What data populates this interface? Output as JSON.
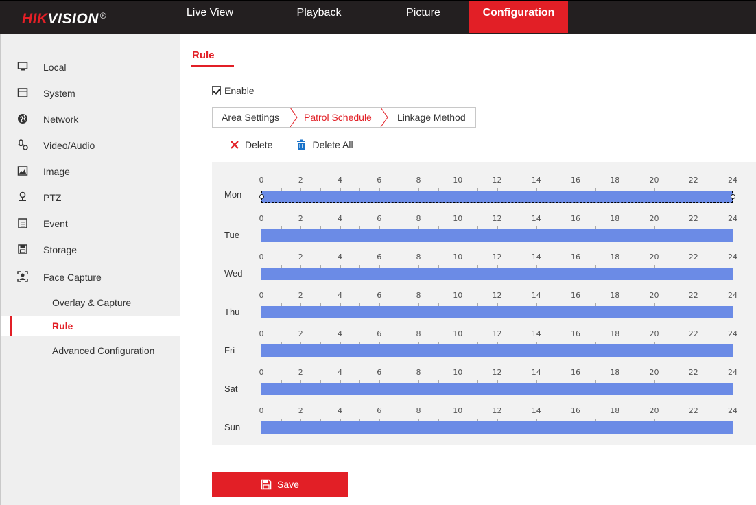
{
  "brand": {
    "logo_red": "HIK",
    "logo_white": "VISION",
    "logo_reg": "®"
  },
  "nav": {
    "tabs": [
      {
        "label": "Live View"
      },
      {
        "label": "Playback"
      },
      {
        "label": "Picture"
      },
      {
        "label": "Configuration",
        "active": true
      }
    ]
  },
  "sidebar": {
    "items": [
      {
        "label": "Local",
        "icon": "monitor-icon"
      },
      {
        "label": "System",
        "icon": "system-icon"
      },
      {
        "label": "Network",
        "icon": "globe-icon"
      },
      {
        "label": "Video/Audio",
        "icon": "video-audio-icon"
      },
      {
        "label": "Image",
        "icon": "image-icon"
      },
      {
        "label": "PTZ",
        "icon": "ptz-icon"
      },
      {
        "label": "Event",
        "icon": "event-icon"
      },
      {
        "label": "Storage",
        "icon": "storage-icon"
      },
      {
        "label": "Face Capture",
        "icon": "face-capture-icon"
      }
    ],
    "subitems": [
      {
        "label": "Overlay & Capture"
      },
      {
        "label": "Rule",
        "active": true
      },
      {
        "label": "Advanced Configuration"
      }
    ]
  },
  "page": {
    "tab_label": "Rule",
    "enable_label": "Enable",
    "enable_checked": true,
    "subtabs": [
      {
        "label": "Area Settings"
      },
      {
        "label": "Patrol Schedule",
        "active": true
      },
      {
        "label": "Linkage Method"
      }
    ],
    "delete_label": "Delete",
    "delete_all_label": "Delete All",
    "save_label": "Save"
  },
  "schedule": {
    "ticks": [
      "0",
      "2",
      "4",
      "6",
      "8",
      "10",
      "12",
      "14",
      "16",
      "18",
      "20",
      "22",
      "24"
    ],
    "days": [
      {
        "label": "Mon",
        "start": 0,
        "end": 24,
        "selected": true
      },
      {
        "label": "Tue",
        "start": 0,
        "end": 24
      },
      {
        "label": "Wed",
        "start": 0,
        "end": 24
      },
      {
        "label": "Thu",
        "start": 0,
        "end": 24
      },
      {
        "label": "Fri",
        "start": 0,
        "end": 24
      },
      {
        "label": "Sat",
        "start": 0,
        "end": 24
      },
      {
        "label": "Sun",
        "start": 0,
        "end": 24
      }
    ]
  },
  "colors": {
    "accent": "#e21f26",
    "bar": "#6b8be6",
    "topbar": "#231f20"
  }
}
